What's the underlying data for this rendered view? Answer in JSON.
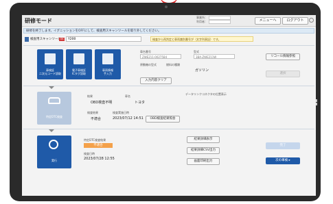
{
  "app": {
    "title": "研修モード"
  },
  "header": {
    "account_lines": [
      "事業所：",
      "利用者："
    ],
    "menu_label": "メニューへ",
    "logout_label": "ログアウト"
  },
  "notice": {
    "text": "研修を終了します。イグニッションをOFFにして、検査用スキャンツールを取り外してください。"
  },
  "scan": {
    "label": "検査用スキャンツール",
    "badge": "OK",
    "value": "Y200",
    "warning": "検査から再判定と車両識別番号が（文字列表記）です。"
  },
  "steps": [
    {
      "label": "車検証\n二次元コード読取"
    },
    {
      "label": "電子車検証\nICタグ読取"
    },
    {
      "label": "車両情報\n手入力"
    }
  ],
  "vehicle": {
    "reg_label": "車台番号",
    "model_label": "型式",
    "reg_placeholder": "ZWE211-0027584",
    "model_placeholder": "3BA-ZWE211W",
    "engine_label": "原動機の型式",
    "fuel_label": "燃料の種類",
    "fuel_value": "ガソリン",
    "clear_button": "入力内容クリア",
    "reread_button": "リコール情報参照",
    "confirm_button": "選択"
  },
  "obd": {
    "result_label": "結果",
    "result_value": "OBD検査不明",
    "maker_label": "車名",
    "maker_value": "トヨタ",
    "dtc_label": "データリンクコネクタの位置表示",
    "judge_label": "検査結果",
    "judge_value": "不適合",
    "date_label": "検査実施日時",
    "date_value": "2023/07/12 14:51",
    "detail_button": "OBD検査結果照会",
    "tile_label": "特定DTC検査"
  },
  "final": {
    "tile_label": "実行",
    "status_label": "特定DTC検査結果",
    "status_value": "不適合",
    "date_label": "検査日時",
    "date_value": "2023/07/28 12:55",
    "btn_results": "結果詳細表示",
    "btn_csv": "結果詳細CSV出力",
    "btn_print": "画面印刷出力",
    "btn_done": "完了",
    "btn_next": "次の車検 ▸"
  }
}
